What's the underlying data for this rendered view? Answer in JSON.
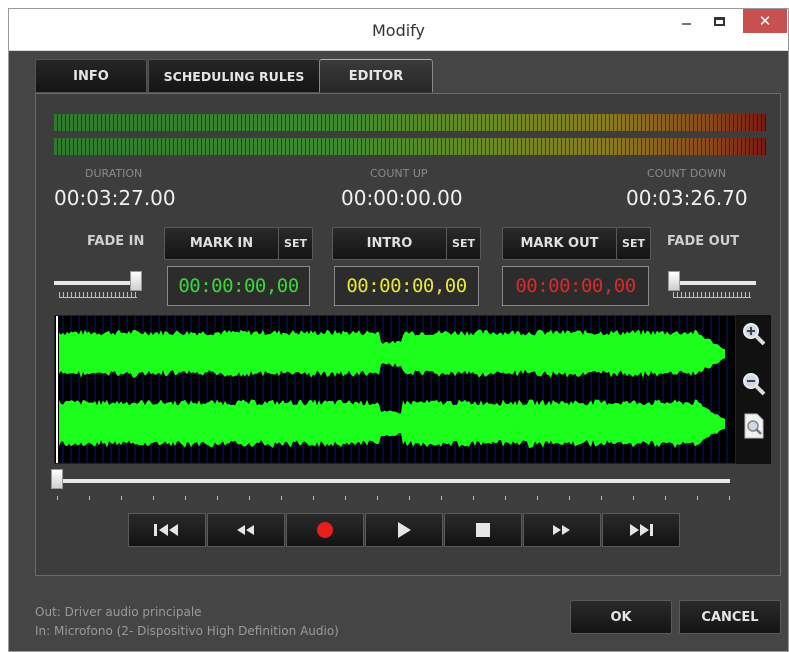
{
  "window": {
    "title": "Modify",
    "close_glyph": "✕"
  },
  "tabs": [
    {
      "label": "INFO"
    },
    {
      "label": "SCHEDULING RULES"
    },
    {
      "label": "EDITOR",
      "active": true
    }
  ],
  "counters": {
    "duration_label": "DURATION",
    "duration_value": "00:03:27.00",
    "countup_label": "COUNT UP",
    "countup_value": "00:00:00.00",
    "countdown_label": "COUNT DOWN",
    "countdown_value": "00:03:26.70"
  },
  "markers": {
    "fade_in_label": "FADE IN",
    "fade_out_label": "FADE OUT",
    "mark_in_label": "MARK IN",
    "intro_label": "INTRO",
    "mark_out_label": "MARK OUT",
    "set_label": "SET",
    "mark_in_value": "00:00:00,00",
    "intro_value": "00:00:00,00",
    "mark_out_value": "00:00:00,00",
    "fade_in_level": 1.0,
    "fade_out_level": 0.0
  },
  "colors": {
    "mark_in": "#3ad63a",
    "intro": "#e6e63a",
    "mark_out": "#d82a2a",
    "waveform": "#1cff1c",
    "waveform_bg": "#000000",
    "record": "#e61e1e"
  },
  "zoom": {
    "in_icon": "zoom-in-icon",
    "out_icon": "zoom-out-icon",
    "fit_icon": "zoom-fit-icon"
  },
  "position": {
    "fraction": 0.0
  },
  "transport": [
    {
      "icon": "skip-to-start-icon"
    },
    {
      "icon": "rewind-icon"
    },
    {
      "icon": "record-icon"
    },
    {
      "icon": "play-icon"
    },
    {
      "icon": "stop-icon"
    },
    {
      "icon": "fast-forward-icon"
    },
    {
      "icon": "skip-to-end-icon"
    }
  ],
  "footer": {
    "out_text": "Out: Driver audio principale",
    "in_text": "In: Microfono (2- Dispositivo High Definition Audio)",
    "ok_label": "OK",
    "cancel_label": "CANCEL"
  }
}
